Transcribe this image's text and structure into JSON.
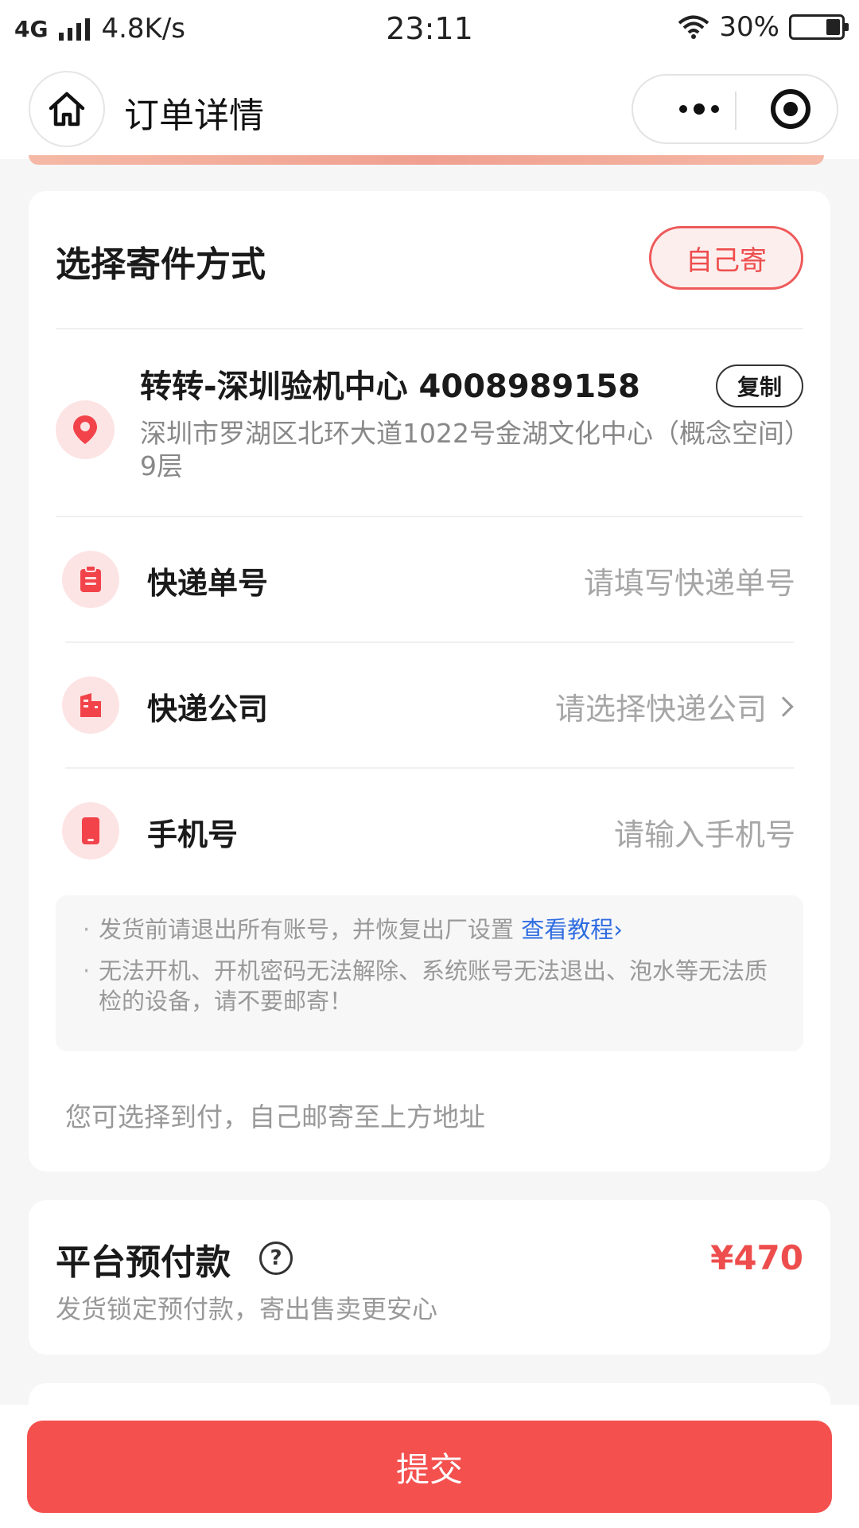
{
  "status_bar": {
    "network": "4G",
    "speed": "4.8K/s",
    "time": "23:11",
    "battery": "30%",
    "battery_level": 0.3
  },
  "nav": {
    "title": "订单详情"
  },
  "shipping": {
    "title": "选择寄件方式",
    "mode_button": "自己寄",
    "address": {
      "name_phone": "转转-深圳验机中心 4008989158",
      "copy_label": "复制",
      "detail": "深圳市罗湖区北环大道1022号金湖文化中心（概念空间）9层"
    },
    "rows": [
      {
        "label": "快递单号",
        "value": "请填写快递单号"
      },
      {
        "label": "快递公司",
        "value": "请选择快递公司"
      },
      {
        "label": "手机号",
        "value": "请输入手机号"
      }
    ],
    "notice": {
      "line1": "发货前请退出所有账号，并恢复出厂设置",
      "link": "查看教程›",
      "line2": "无法开机、开机密码无法解除、系统账号无法退出、泡水等无法质检的设备，请不要邮寄！"
    },
    "hint": "您可选择到付，自己邮寄至上方地址"
  },
  "prepay": {
    "title": "平台预付款",
    "help": "?",
    "amount": "¥470",
    "desc": "发货锁定预付款，寄出售卖更安心"
  },
  "submit": {
    "label": "提交"
  },
  "colors": {
    "accent": "#f4504e",
    "link": "#2f6ce0"
  }
}
